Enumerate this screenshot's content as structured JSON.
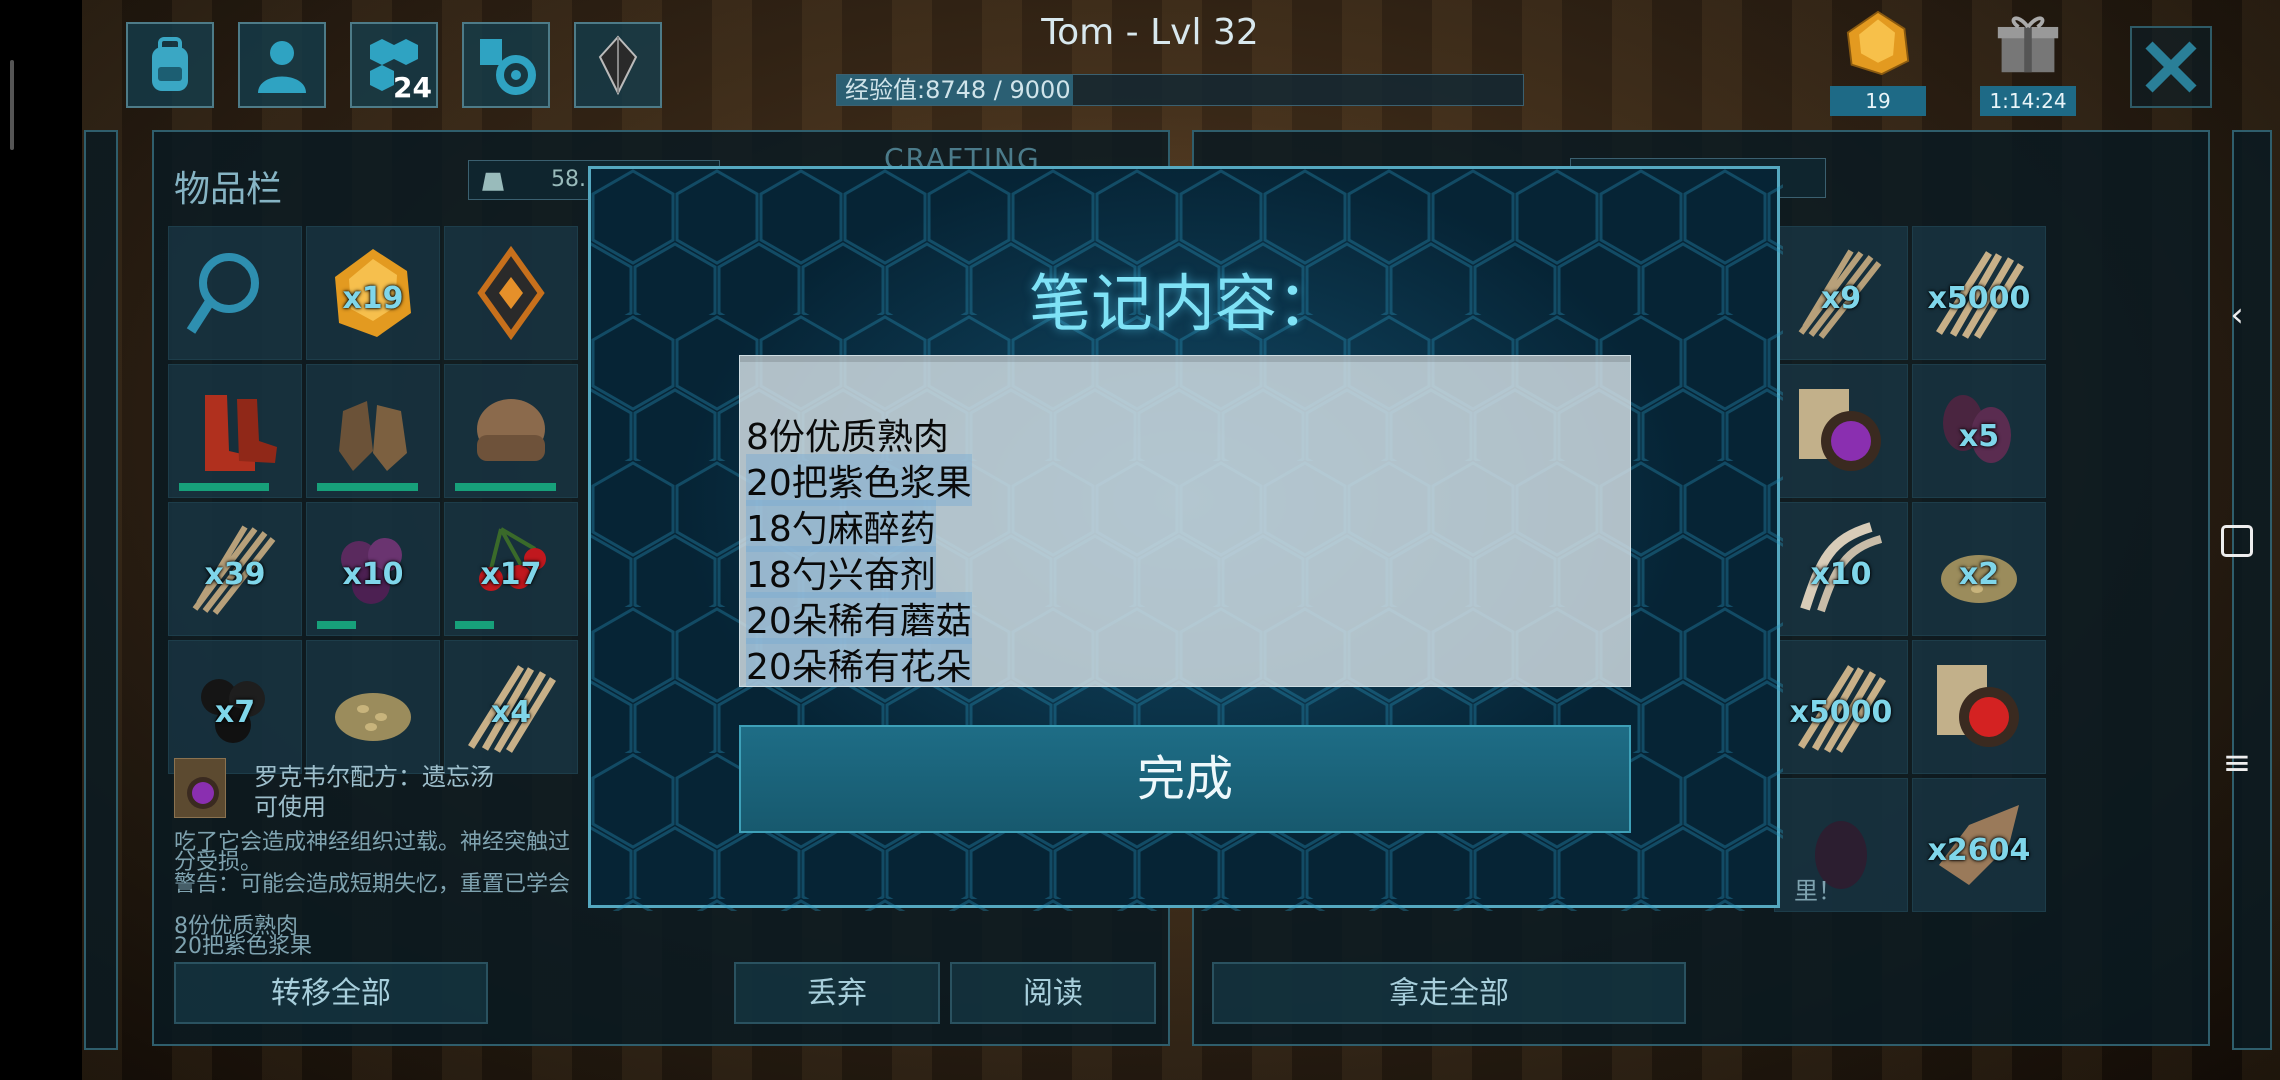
{
  "header": {
    "title": "Tom - Lvl 32",
    "xp_text": "经验值:8748 / 9000",
    "xp_fraction": 0.344,
    "engram_badge": "24",
    "resource_count": "19",
    "gift_timer": "1:14:24"
  },
  "inventory": {
    "title": "物品栏",
    "weight_partial": "58.",
    "crafting_tab": "CRAFTING",
    "slots": [
      {
        "icon": "magnifier-icon",
        "qty": ""
      },
      {
        "icon": "amber-icon",
        "qty": "x19"
      },
      {
        "icon": "implant-icon",
        "qty": ""
      },
      {
        "icon": "boots-icon",
        "qty": "",
        "durability": 0.8
      },
      {
        "icon": "gloves-icon",
        "qty": "",
        "durability": 0.9
      },
      {
        "icon": "hat-icon",
        "qty": "",
        "durability": 0.9
      },
      {
        "icon": "fiber-icon",
        "qty": "x39"
      },
      {
        "icon": "berries-icon",
        "qty": "x10",
        "durability": 0.35
      },
      {
        "icon": "cherries-icon",
        "qty": "x17",
        "durability": 0.35
      },
      {
        "icon": "blackberries-icon",
        "qty": "x7"
      },
      {
        "icon": "seeds-icon",
        "qty": ""
      },
      {
        "icon": "thatch-icon",
        "qty": "x4"
      }
    ],
    "selected_item": {
      "name": "罗克韦尔配方：遗忘汤",
      "status": "可使用",
      "desc1": "吃了它会造成神经组织过载。神经突触过",
      "desc2": "分受损。",
      "warning": "警告：可能会造成短期失忆，重置已学会",
      "note1": "8份优质熟肉",
      "note2": "20把紫色浆果"
    },
    "buttons": {
      "transfer_all": "转移全部",
      "drop": "丢弃",
      "read": "阅读"
    }
  },
  "container": {
    "slots": [
      {
        "icon": "fiber-icon",
        "qty": "x9"
      },
      {
        "icon": "thatch-icon",
        "qty": "x5000"
      },
      {
        "icon": "recipe-purple-icon",
        "qty": ""
      },
      {
        "icon": "eggs-icon",
        "qty": "x5"
      },
      {
        "icon": "bone-icon",
        "qty": "x10"
      },
      {
        "icon": "seeds-icon",
        "qty": "x2"
      },
      {
        "icon": "thatch-icon",
        "qty": "x5000"
      },
      {
        "icon": "recipe-red-icon",
        "qty": ""
      },
      {
        "icon": "egg-dark-icon",
        "qty": ""
      },
      {
        "icon": "hide-icon",
        "qty": "x2604"
      }
    ],
    "footer_text": "里！",
    "take_all": "拿走全部"
  },
  "modal": {
    "title": "笔记内容：",
    "lines": [
      "8份优质熟肉",
      "20把紫色浆果",
      "18勺麻醉药",
      "18勺兴奋剂",
      "20朵稀有蘑菇",
      "20朵稀有花朵"
    ],
    "done": "完成"
  },
  "colors": {
    "accent": "#7fe2f6",
    "panel_border": "#2f5e6c",
    "button": "#1e6d86"
  }
}
